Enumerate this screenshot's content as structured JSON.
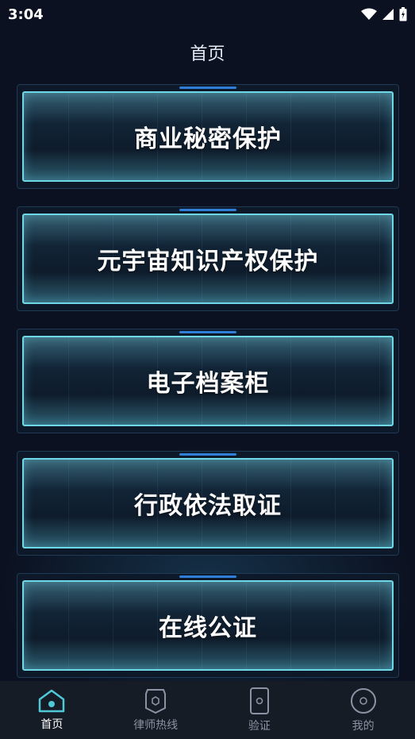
{
  "status_bar": {
    "time": "3:04"
  },
  "header": {
    "title": "首页"
  },
  "cards": [
    {
      "label": "商业秘密保护"
    },
    {
      "label": "元宇宙知识产权保护"
    },
    {
      "label": "电子档案柜"
    },
    {
      "label": "行政依法取证"
    },
    {
      "label": "在线公证"
    }
  ],
  "tabbar": {
    "items": [
      {
        "label": "首页",
        "icon": "home-icon",
        "active": true
      },
      {
        "label": "律师热线",
        "icon": "lawyer-shield-icon",
        "active": false
      },
      {
        "label": "验证",
        "icon": "verify-phone-icon",
        "active": false
      },
      {
        "label": "我的",
        "icon": "profile-circle-icon",
        "active": false
      }
    ]
  },
  "colors": {
    "background": "#0b1120",
    "accent": "#6fd8e6",
    "tab_active": "#4fc8d8"
  }
}
